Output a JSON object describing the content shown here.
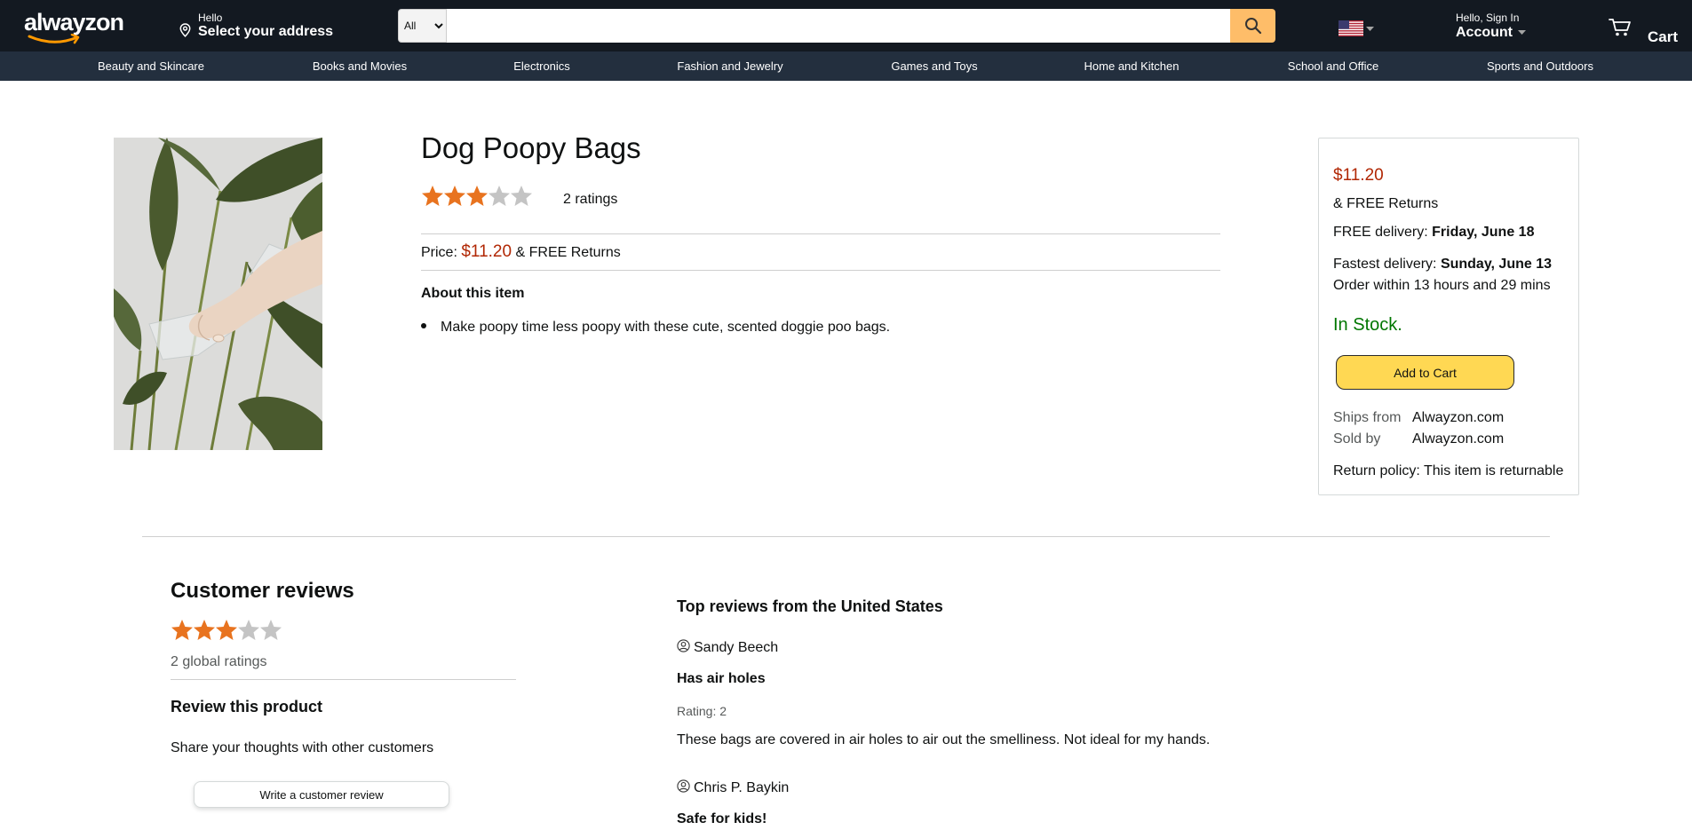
{
  "header": {
    "logo_text": "alwayzon",
    "address_hello": "Hello",
    "address_select": "Select your address",
    "search": {
      "category": "All",
      "placeholder": ""
    },
    "account_small": "Hello, Sign In",
    "account_big": "Account",
    "cart_label": "Cart"
  },
  "nav": {
    "items": [
      "Beauty and Skincare",
      "Books and Movies",
      "Electronics",
      "Fashion and Jewelry",
      "Games and Toys",
      "Home and Kitchen",
      "School and Office",
      "Sports and Outdoors"
    ]
  },
  "product": {
    "title": "Dog Poopy Bags",
    "rating": 3,
    "rating_max": 5,
    "ratings_count": "2 ratings",
    "price_label": "Price:",
    "price": "$11.20",
    "price_suffix": "& FREE Returns",
    "about_heading": "About this item",
    "bullets": [
      "Make poopy time less poopy with these cute, scented doggie poo bags."
    ]
  },
  "buybox": {
    "price": "$11.20",
    "returns": "& FREE Returns",
    "free_delivery_label": "FREE delivery:",
    "free_delivery_date": "Friday, June 18",
    "fastest_label": "Fastest delivery:",
    "fastest_date": "Sunday, June 13",
    "order_within": "Order within 13 hours and 29 mins",
    "stock": "In Stock.",
    "add_to_cart": "Add to Cart",
    "ships_from_label": "Ships from",
    "ships_from_value": "Alwayzon.com",
    "sold_by_label": "Sold by",
    "sold_by_value": "Alwayzon.com",
    "return_policy": "Return policy: This item is returnable"
  },
  "reviews": {
    "title": "Customer reviews",
    "rating": 3,
    "global_ratings": "2 global ratings",
    "review_heading": "Review this product",
    "share_text": "Share your thoughts with other customers",
    "write_button": "Write a customer review",
    "top_heading": "Top reviews from the United States",
    "items": [
      {
        "author": "Sandy Beech",
        "title": "Has air holes",
        "rating_text": "Rating: 2",
        "body": "These bags are covered in air holes to air out the smelliness. Not ideal for my hands."
      },
      {
        "author": "Chris P. Baykin",
        "title": "Safe for kids!",
        "rating_text": "",
        "body": ""
      }
    ]
  },
  "colors": {
    "header_bg": "#131921",
    "nav_bg": "#232f3e",
    "search_button": "#febd69",
    "price": "#b12704",
    "in_stock": "#007600",
    "star_filled": "#e8731f",
    "star_empty": "#c4c4c4",
    "add_to_cart_bg": "#ffd853"
  },
  "icons": {
    "location": "location-pin-icon",
    "search": "magnifier-icon",
    "flag": "us-flag-icon",
    "cart": "cart-icon",
    "user": "user-circle-icon",
    "star": "star-icon"
  }
}
